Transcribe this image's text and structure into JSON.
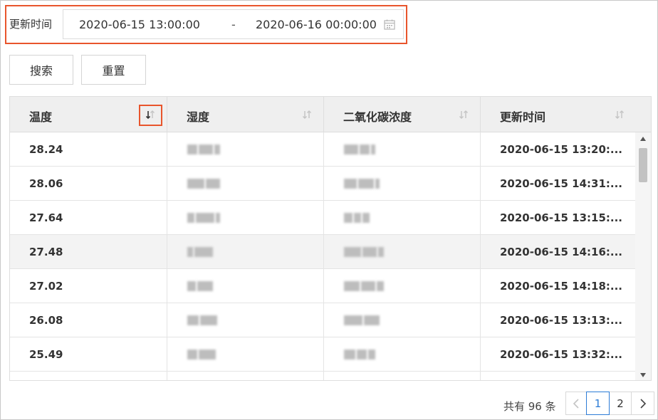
{
  "filter": {
    "label": "更新时间",
    "start": "2020-06-15 13:00:00",
    "separator": "-",
    "end": "2020-06-16 00:00:00"
  },
  "buttons": {
    "search": "搜索",
    "reset": "重置"
  },
  "table": {
    "columns": [
      "温度",
      "湿度",
      "二氧化碳浓度",
      "更新时间"
    ],
    "rows": [
      {
        "temperature": "28.24",
        "updated": "2020-06-15 13:20:..."
      },
      {
        "temperature": "28.06",
        "updated": "2020-06-15 14:31:..."
      },
      {
        "temperature": "27.64",
        "updated": "2020-06-15 13:15:..."
      },
      {
        "temperature": "27.48",
        "updated": "2020-06-15 14:16:..."
      },
      {
        "temperature": "27.02",
        "updated": "2020-06-15 14:18:..."
      },
      {
        "temperature": "26.08",
        "updated": "2020-06-15 13:13:..."
      },
      {
        "temperature": "25.49",
        "updated": "2020-06-15 13:32:..."
      }
    ]
  },
  "pagination": {
    "total": "共有 96 条",
    "pages": [
      "1",
      "2"
    ],
    "current": "1"
  },
  "colors": {
    "highlight": "#e8552c",
    "active_page": "#2d7cd6",
    "header_bg": "#efefef"
  }
}
